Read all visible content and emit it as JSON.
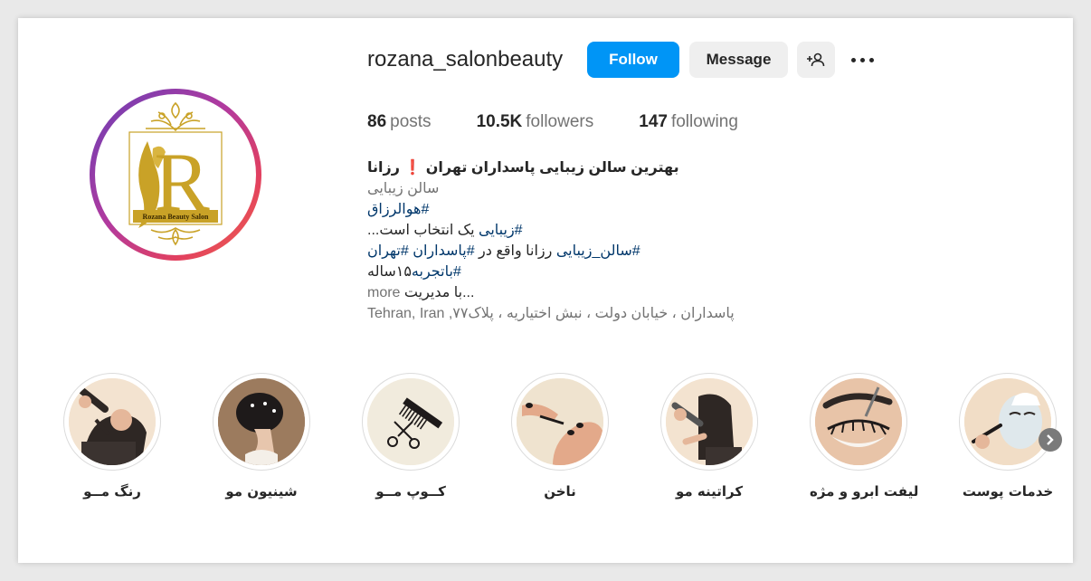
{
  "profile": {
    "username": "rozana_salonbeauty",
    "follow_label": "Follow",
    "message_label": "Message",
    "logo_text": "Rozana Beauty Salon"
  },
  "stats": {
    "posts_count": "86",
    "posts_label": "posts",
    "followers_count": "10.5K",
    "followers_label": "followers",
    "following_count": "147",
    "following_label": "following"
  },
  "bio": {
    "name": "بهترین سالن زیبایی پاسداران تهران ❗ رزانا",
    "category": "سالن زیبایی",
    "line1": "#هوالرزاق",
    "line2_tag": "#زیبایی",
    "line2_rest": " یک انتخاب است...",
    "line3_tag1": "#سالن_زیبایی",
    "line3_mid": " رزانا واقع در ",
    "line3_tag2": "#پاسداران",
    "line3_tag3": "#تهران",
    "line4_tag": "#باتجربه",
    "line4_rest": "۱۵ساله",
    "line5": "...با مدیریت",
    "more": " more",
    "address": "پاسداران ، خیابان دولت ، نبش اختیاریه ، پلاک۷۷, Tehran, Iran"
  },
  "highlights": [
    {
      "label": "رنگ مــو"
    },
    {
      "label": "شینیون مو"
    },
    {
      "label": "کــوپ مــو"
    },
    {
      "label": "ناخن"
    },
    {
      "label": "کراتینه مو"
    },
    {
      "label": "لیفت ابرو و مژه"
    },
    {
      "label": "خدمات پوست"
    }
  ],
  "colors": {
    "follow": "#0095f6",
    "hashtag": "#00376b",
    "gold": "#c9a227"
  }
}
